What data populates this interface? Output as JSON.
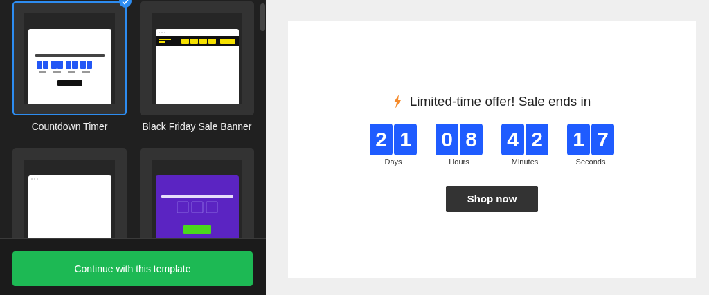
{
  "templates": [
    {
      "kind": "countdown",
      "name": "Countdown Timer",
      "selected": true
    },
    {
      "kind": "banner",
      "name": "Black Friday Sale Banner",
      "selected": false
    },
    {
      "kind": "blank",
      "selected": false
    },
    {
      "kind": "purple",
      "selected": false
    }
  ],
  "continue_button": "Continue with this template",
  "preview": {
    "headline": "Limited-time offer! Sale ends in",
    "units": [
      {
        "digits": [
          "2",
          "1"
        ],
        "label": "Days"
      },
      {
        "digits": [
          "0",
          "8"
        ],
        "label": "Hours"
      },
      {
        "digits": [
          "4",
          "2"
        ],
        "label": "Minutes"
      },
      {
        "digits": [
          "1",
          "7"
        ],
        "label": "Seconds"
      }
    ],
    "button": "Shop now"
  }
}
